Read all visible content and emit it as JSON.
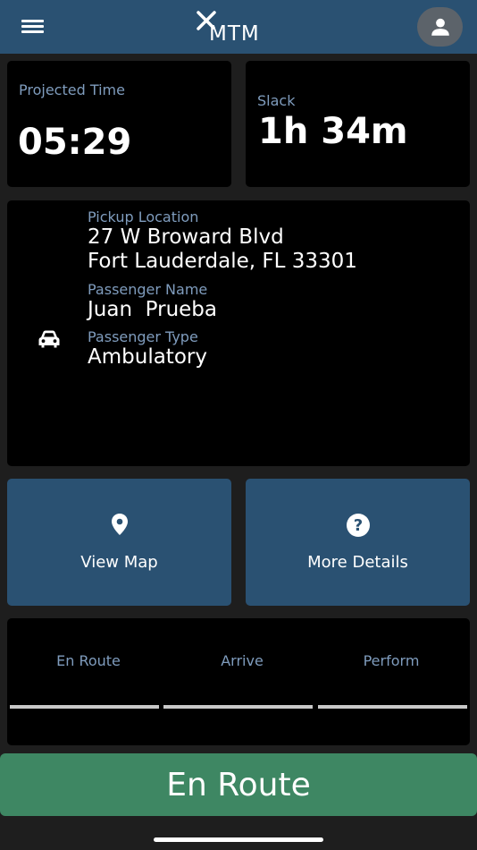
{
  "header": {
    "logo_text": "MTM"
  },
  "projected_time": {
    "label": "Projected Time",
    "value": "05:29"
  },
  "slack": {
    "label": "Slack",
    "value": "1h 34m"
  },
  "trip": {
    "pickup_label": "Pickup Location",
    "pickup_line1": "27 W Broward Blvd",
    "pickup_line2": "Fort Lauderdale, FL 33301",
    "passenger_name_label": "Passenger Name",
    "passenger_name": "Juan  Prueba",
    "passenger_type_label": "Passenger Type",
    "passenger_type": "Ambulatory",
    "vehicle_icon": "car-icon"
  },
  "tiles": {
    "map_label": "View Map",
    "map_icon": "map-pin-icon",
    "details_label": "More Details",
    "details_icon": "help-icon"
  },
  "steps": [
    "En Route",
    "Arrive",
    "Perform"
  ],
  "action": {
    "label": "En Route"
  },
  "colors": {
    "header": "#2a5172",
    "label": "#7f9cbd",
    "action": "#3e8763",
    "tile": "#2a5172"
  }
}
